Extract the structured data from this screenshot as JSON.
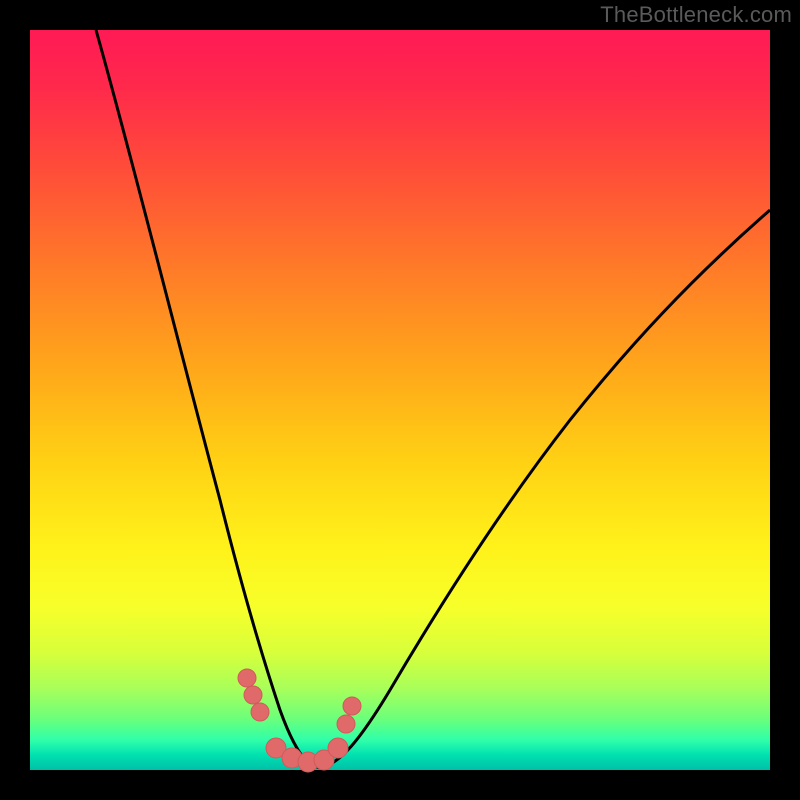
{
  "watermark": "TheBottleneck.com",
  "chart_data": {
    "type": "line",
    "title": "",
    "xlabel": "",
    "ylabel": "",
    "xlim": [
      0,
      100
    ],
    "ylim": [
      0,
      100
    ],
    "series": [
      {
        "name": "left-curve",
        "x": [
          9,
          12,
          15,
          18,
          21,
          24,
          27,
          28.5,
          30,
          31.5,
          33,
          34.5,
          36,
          37.5,
          39
        ],
        "values": [
          100,
          92,
          83,
          73,
          62,
          50,
          36,
          28,
          20,
          13,
          7,
          3,
          1,
          0,
          0
        ]
      },
      {
        "name": "right-curve",
        "x": [
          39,
          42,
          46,
          52,
          58,
          64,
          70,
          76,
          82,
          88,
          94,
          100
        ],
        "values": [
          0,
          2,
          6,
          13,
          21,
          30,
          39,
          48,
          56,
          63,
          70,
          76
        ]
      },
      {
        "name": "bottom-dots",
        "x": [
          29,
          30,
          31,
          33,
          35,
          37,
          39,
          41,
          42,
          43
        ],
        "values": [
          13,
          10,
          8,
          2,
          1,
          1,
          1,
          4,
          7,
          10
        ]
      }
    ],
    "colors": {
      "curve": "#000000",
      "dots": "#e06a6a"
    }
  }
}
